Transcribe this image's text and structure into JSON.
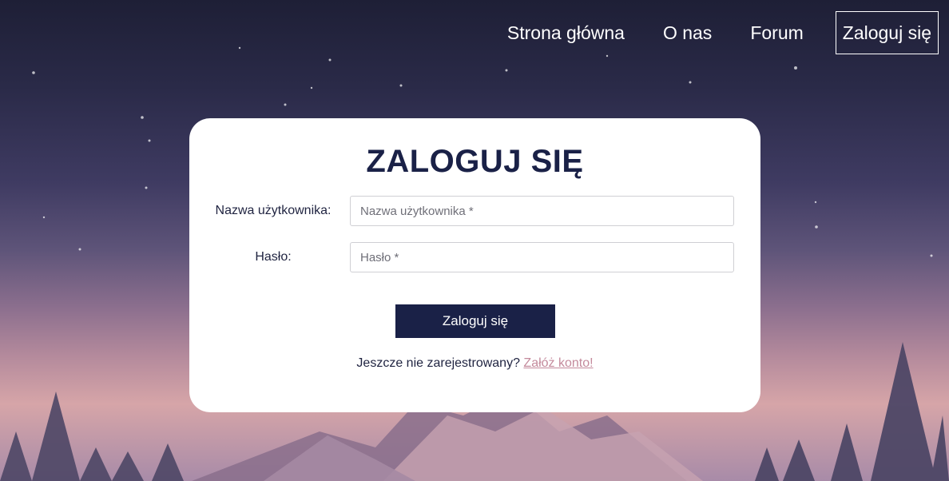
{
  "nav": {
    "items": [
      {
        "label": "Strona główna"
      },
      {
        "label": "O nas"
      },
      {
        "label": "Forum"
      },
      {
        "label": "Zaloguj się"
      }
    ]
  },
  "login": {
    "title": "ZALOGUJ SIĘ",
    "username": {
      "label": "Nazwa użytkownika:",
      "placeholder": "Nazwa użytkownika *",
      "value": ""
    },
    "password": {
      "label": "Hasło:",
      "placeholder": "Hasło *",
      "value": ""
    },
    "submit_label": "Zaloguj się",
    "register_text": "Jeszcze nie zarejestrowany?",
    "register_link": "Załóż konto!"
  },
  "colors": {
    "accent": "#1a2147",
    "link": "#c48a9c",
    "card": "#ffffff"
  }
}
